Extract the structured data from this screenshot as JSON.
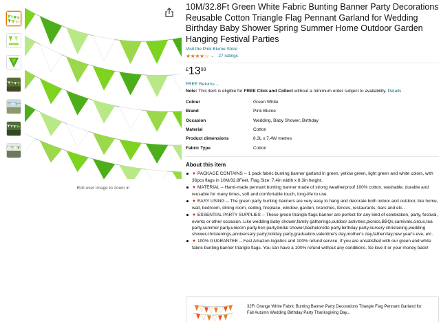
{
  "product": {
    "title": "10M/32.8Ft Green White Fabric Bunting Banner Party Decorations Reusable Cotton Triangle Flag Pennant Garland for Wedding Birthday Baby Shower Spring Summer Home Outdoor Garden Hanging Festival Parties",
    "store_link": "Visit the Pink Blume Store",
    "rating_stars": "★★★★☆",
    "rating_chevron": "⌄",
    "ratings_count": "27 ratings",
    "price": {
      "symbol": "£",
      "whole": "13",
      "fraction": "99"
    },
    "returns_label": "FREE Returns",
    "returns_chevron": "⌄",
    "note": {
      "label": "Note:",
      "text_before": " This item is eligible for ",
      "bold": "FREE Click and Collect",
      "text_after": " without a minimum order subject to availability. ",
      "link": "Details"
    }
  },
  "specs": [
    {
      "key": "Colour",
      "value": "Green White"
    },
    {
      "key": "Brand",
      "value": "Pink Blume"
    },
    {
      "key": "Occasion",
      "value": "Wedding, Baby Shower, Birthday"
    },
    {
      "key": "Material",
      "value": "Cotton"
    },
    {
      "key": "Product dimensions",
      "value": "8.3L x 7.4W metres"
    },
    {
      "key": "Fabric Type",
      "value": "Cotton"
    }
  ],
  "about": {
    "title": "About this item",
    "bullets": [
      {
        "marker": "▼",
        "text": "PACKAGE CONTAINS -- 1 pack fabric bunting banner garland in green, yellow green, light green and white colors, with 36pcs flags in 10M/32.8Feet. Flag Size: 7.4in width x 8.3in height."
      },
      {
        "marker": "▼",
        "text": "MATERIAL -- Hand-made pennant bunting banner made of strong weatherproof 100% cotton, washable, durable and reusable for many times, soft and comfortable touch, long-life to use."
      },
      {
        "marker": "▼",
        "text": "EASY USING -- The green party bunting banners are very easy to hang and decorate both indoor and outdoor, like home, wall, bedroom, dining room, ceiling, fireplace, window, garden, branches, fences, restaurants, bars and etc.."
      },
      {
        "marker": "▼",
        "text": "ESSENTIAL PARTY SUPPLIES -- These green triangle flags banner are perfect for any kind of celebration, party, festival, events or other occasion. Like wedding,baby shower,family gatherings,outdoor activities,picnics,BBQs,carnivals,circus,tea party,summer party,unicorn party,hen party,bridal shower,bachelorette party,birthday party,nursery christening,wedding shower,christenings,anniversary party,holiday party,graduation,valentine's day,mother's day,father'day,new year's eve, etc."
      },
      {
        "marker": "▼",
        "text": "100% GUARANTEE -- Fast Amazon logistics and 100% refund service. If you are unsatisfied with our green and white fabric bunting banner triangle flags. You can have a 100% refund without any conditions. So love it or your money back!"
      }
    ]
  },
  "image": {
    "zoom_hint": "Roll over image to zoom in",
    "flag_colors": [
      "#7ed321",
      "#4caf1a",
      "#b8e986",
      "#ffffff",
      "#9bd84a"
    ]
  },
  "sponsored": {
    "text": "32Ft Orange White Fabric Bunting Banner Party Decorations Triangle Flag Pennant Garland for Fall Autumn Wedding Birthday Party Thanksgiving Day..."
  },
  "icons": {
    "share": "share-icon"
  }
}
